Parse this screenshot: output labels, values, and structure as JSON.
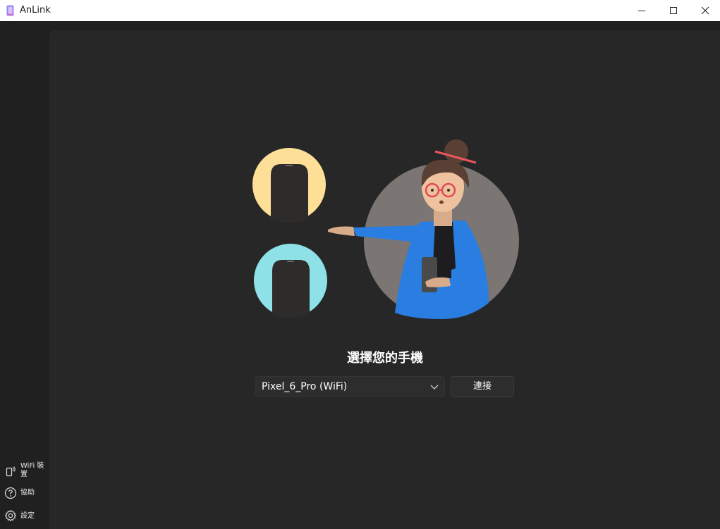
{
  "app": {
    "title": "AnLink"
  },
  "main": {
    "heading": "選擇您的手機",
    "device_select": {
      "value": "Pixel_6_Pro (WiFi)"
    },
    "connect_label": "連接"
  },
  "sidebar": {
    "items": [
      {
        "label": "WiFi 裝置",
        "icon": "wifi-device-icon"
      },
      {
        "label": "協助",
        "icon": "help-icon"
      },
      {
        "label": "設定",
        "icon": "gear-icon"
      }
    ]
  },
  "colors": {
    "background": "#202020",
    "content": "#272727",
    "accent_blue": "#2a7de1",
    "yellow_circle": "#fddf97",
    "cyan_circle": "#8fe1e8"
  }
}
